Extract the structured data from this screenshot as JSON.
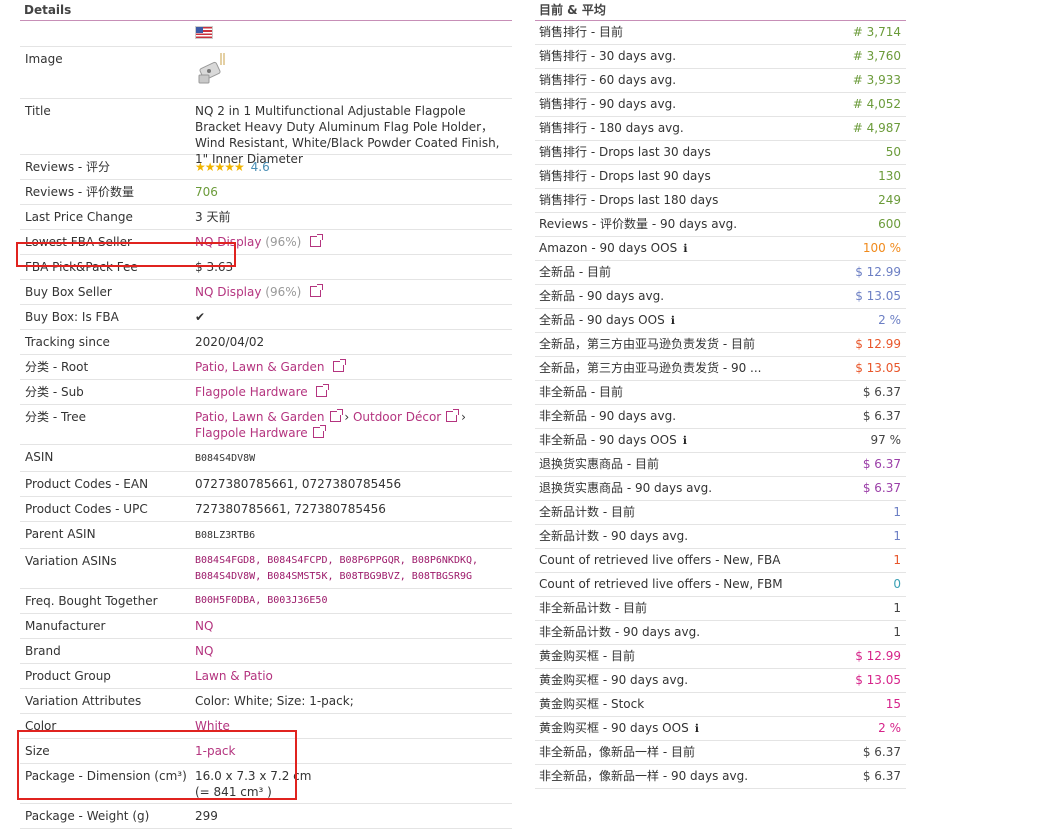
{
  "details": {
    "title": "Details",
    "image_label": "Image",
    "title_label": "Title",
    "title_value": "NQ 2 in 1 Multifunctional Adjustable Flagpole Bracket Heavy Duty Aluminum Flag Pole Holder，Wind Resistant, White/Black Powder Coated Finish, 1\" Inner Diameter",
    "reviews_rating_label": "Reviews - 评分",
    "reviews_rating_stars": "★★★★★",
    "reviews_rating_value": "4.6",
    "reviews_count_label": "Reviews - 评价数量",
    "reviews_count_value": "706",
    "last_price_change_label": "Last Price Change",
    "last_price_change_value": "3 天前",
    "lowest_fba_seller_label": "Lowest FBA Seller",
    "lowest_fba_seller_value": "NQ Display",
    "lowest_fba_seller_pct": "(96%)",
    "fba_fee_label": "FBA Pick&Pack Fee",
    "fba_fee_value": "$ 3.63",
    "buy_box_seller_label": "Buy Box Seller",
    "buy_box_seller_value": "NQ Display",
    "buy_box_seller_pct": "(96%)",
    "buy_box_fba_label": "Buy Box: Is FBA",
    "buy_box_fba_value": "✔",
    "tracking_since_label": "Tracking since",
    "tracking_since_value": "2020/04/02",
    "cat_root_label": "分类 - Root",
    "cat_root_value": "Patio, Lawn & Garden",
    "cat_sub_label": "分类 - Sub",
    "cat_sub_value": "Flagpole Hardware",
    "cat_tree_label": "分类 - Tree",
    "cat_tree_1": "Patio, Lawn & Garden",
    "cat_tree_2": "Outdoor Décor",
    "cat_tree_3": "Flagpole Hardware",
    "asin_label": "ASIN",
    "asin_value": "B084S4DV8W",
    "ean_label": "Product Codes - EAN",
    "ean_value": "0727380785661, 0727380785456",
    "upc_label": "Product Codes - UPC",
    "upc_value": "727380785661, 727380785456",
    "parent_asin_label": "Parent ASIN",
    "parent_asin_value": "B08LZ3RTB6",
    "variation_asins_label": "Variation ASINs",
    "variation_asins": [
      "B084S4FGD8",
      "B084S4FCPD",
      "B08P6PPGQR",
      "B08P6NKDKQ",
      "B084S4DV8W",
      "B084SMST5K",
      "B08TBG9BVZ",
      "B08TBGSR9G"
    ],
    "freq_bought_label": "Freq. Bought Together",
    "freq_bought": [
      "B00H5F0DBA",
      "B003J36E50"
    ],
    "manufacturer_label": "Manufacturer",
    "manufacturer_value": "NQ",
    "brand_label": "Brand",
    "brand_value": "NQ",
    "product_group_label": "Product Group",
    "product_group_value": "Lawn & Patio",
    "variation_attr_label": "Variation Attributes",
    "variation_attr_value": "Color: White; Size: 1-pack;",
    "color_label": "Color",
    "color_value": "White",
    "size_label": "Size",
    "size_value": "1-pack",
    "dimension_label": "Package - Dimension (cm³)",
    "dimension_value": "16.0 x 7.3 x 7.2 cm",
    "dimension_volume": "(= 841 cm³ )",
    "weight_label": "Package - Weight (g)",
    "weight_value": "299"
  },
  "current_avg": {
    "title": "目前 & 平均",
    "rows": [
      {
        "label": "销售排行 - 目前",
        "value": "# 3,714",
        "color": "#6b9b3a"
      },
      {
        "label": "销售排行 - 30 days avg.",
        "value": "# 3,760",
        "color": "#6b9b3a"
      },
      {
        "label": "销售排行 - 60 days avg.",
        "value": "# 3,933",
        "color": "#6b9b3a"
      },
      {
        "label": "销售排行 - 90 days avg.",
        "value": "# 4,052",
        "color": "#6b9b3a"
      },
      {
        "label": "销售排行 - 180 days avg.",
        "value": "# 4,987",
        "color": "#6b9b3a"
      },
      {
        "label": "销售排行 - Drops last 30 days",
        "value": "50",
        "color": "#6b9b3a"
      },
      {
        "label": "销售排行 - Drops last 90 days",
        "value": "130",
        "color": "#6b9b3a"
      },
      {
        "label": "销售排行 - Drops last 180 days",
        "value": "249",
        "color": "#6b9b3a"
      },
      {
        "label": "Reviews - 评价数量 - 90 days avg.",
        "value": "600",
        "color": "#6b9b3a"
      },
      {
        "label": "Amazon - 90 days OOS",
        "value": "100 %",
        "color": "#f08a1c",
        "info": "ℹ"
      },
      {
        "label": "全新品 - 目前",
        "value": "$ 12.99",
        "color": "#6c7fc4"
      },
      {
        "label": "全新品 - 90 days avg.",
        "value": "$ 13.05",
        "color": "#6c7fc4"
      },
      {
        "label": "全新品 - 90 days OOS",
        "value": "2 %",
        "color": "#6c7fc4",
        "info": "ℹ"
      },
      {
        "label": "全新品，第三方由亚马逊负责发货 - 目前",
        "value": "$ 12.99",
        "color": "#e8562a"
      },
      {
        "label": "全新品，第三方由亚马逊负责发货 - 90 ...",
        "value": "$ 13.05",
        "color": "#e8562a"
      },
      {
        "label": "非全新品 - 目前",
        "value": "$ 6.37",
        "color": "#444444"
      },
      {
        "label": "非全新品 - 90 days avg.",
        "value": "$ 6.37",
        "color": "#444444"
      },
      {
        "label": "非全新品 - 90 days OOS",
        "value": "97 %",
        "color": "#444444",
        "info": "ℹ"
      },
      {
        "label": "退换货实惠商品 - 目前",
        "value": "$ 6.37",
        "color": "#9b3fa8"
      },
      {
        "label": "退换货实惠商品 - 90 days avg.",
        "value": "$ 6.37",
        "color": "#9b3fa8"
      },
      {
        "label": "全新品计数 - 目前",
        "value": "1",
        "color": "#6c7fc4"
      },
      {
        "label": "全新品计数 - 90 days avg.",
        "value": "1",
        "color": "#6c7fc4"
      },
      {
        "label": "Count of retrieved live offers - New, FBA",
        "value": "1",
        "color": "#e8562a"
      },
      {
        "label": "Count of retrieved live offers - New, FBM",
        "value": "0",
        "color": "#3aa0b4"
      },
      {
        "label": "非全新品计数 - 目前",
        "value": "1",
        "color": "#444444"
      },
      {
        "label": "非全新品计数 - 90 days avg.",
        "value": "1",
        "color": "#444444"
      },
      {
        "label": "黄金购买框 - 目前",
        "value": "$ 12.99",
        "color": "#d6238a"
      },
      {
        "label": "黄金购买框 - 90 days avg.",
        "value": "$ 13.05",
        "color": "#d6238a"
      },
      {
        "label": "黄金购买框 - Stock",
        "value": "15",
        "color": "#d6238a"
      },
      {
        "label": "黄金购买框 - 90 days OOS",
        "value": "2 %",
        "color": "#d6238a",
        "info": "ℹ"
      },
      {
        "label": "非全新品，像新品一样 - 目前",
        "value": "$ 6.37",
        "color": "#444444"
      },
      {
        "label": "非全新品，像新品一样 - 90 days avg.",
        "value": "$ 6.37",
        "color": "#444444"
      }
    ]
  },
  "icons": {
    "flag": "us-flag-icon",
    "external": "external-link-icon",
    "info": "info-icon",
    "check": "check-icon",
    "stars": "star-rating-icon"
  }
}
